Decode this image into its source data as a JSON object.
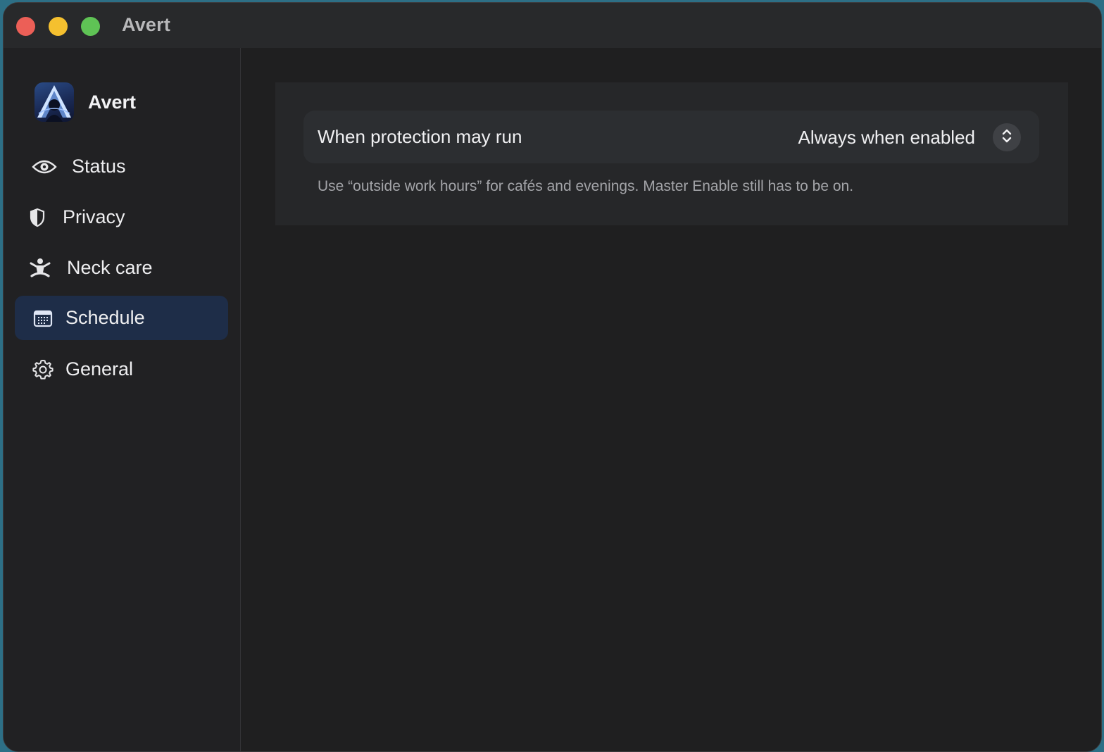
{
  "window": {
    "title": "Avert"
  },
  "sidebar": {
    "brand": {
      "name": "Avert",
      "icon": "avert-logo"
    },
    "items": [
      {
        "label": "Status",
        "icon": "eye-icon",
        "active": false
      },
      {
        "label": "Privacy",
        "icon": "shield-icon",
        "active": false
      },
      {
        "label": "Neck care",
        "icon": "figure-stretch-icon",
        "active": false
      },
      {
        "label": "Schedule",
        "icon": "calendar-icon",
        "active": true
      },
      {
        "label": "General",
        "icon": "gear-icon",
        "active": false
      }
    ]
  },
  "main": {
    "schedule": {
      "row_label": "When protection may run",
      "selected_value": "Always when enabled",
      "help": "Use “outside work hours” for cafés and evenings. Master Enable still has to be on."
    }
  },
  "colors": {
    "close": "#ec5f57",
    "minimize": "#f5c02f",
    "maximize": "#5fc355",
    "active_nav_bg": "#1e2d48",
    "window_bg": "#1f1f20",
    "panel_bg": "#262729",
    "row_bg": "#2c2e31"
  }
}
